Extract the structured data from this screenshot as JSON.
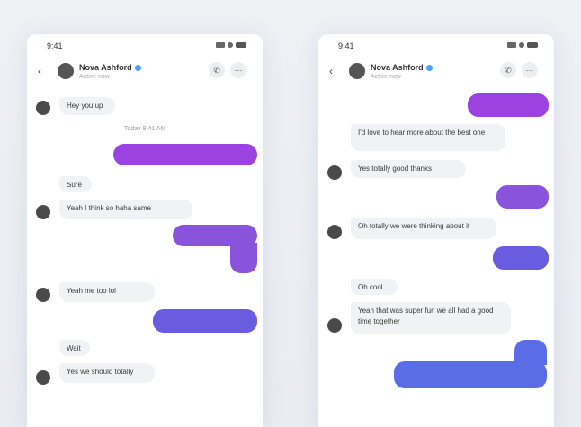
{
  "status_bar": {
    "time": "9:41"
  },
  "contact": {
    "name": "Nova Ashford",
    "subtitle": "Active now"
  },
  "icons": {
    "back": "‹",
    "call": "✆",
    "more": "⋯"
  },
  "left_chat": {
    "messages": [
      {
        "text": "Hey you up"
      },
      {
        "text": ""
      },
      {
        "text": "Sure"
      },
      {
        "text": "Yeah I think so haha same"
      },
      {
        "text": ""
      },
      {
        "text": "Yeah me too lol"
      },
      {
        "text": ""
      },
      {
        "text": "Wait"
      },
      {
        "text": "Yes we should totally"
      }
    ],
    "timestamp": "Today 9:41 AM"
  },
  "right_chat": {
    "messages": [
      {
        "text": ""
      },
      {
        "text": "I'd love to hear more about the best one"
      },
      {
        "text": "Yes totally good thanks"
      },
      {
        "text": ""
      },
      {
        "text": "Oh totally we were thinking about it"
      },
      {
        "text": ""
      },
      {
        "text": "Oh cool"
      },
      {
        "text": "Yeah that was super fun we all had a good time together"
      },
      {
        "text": ""
      }
    ]
  }
}
